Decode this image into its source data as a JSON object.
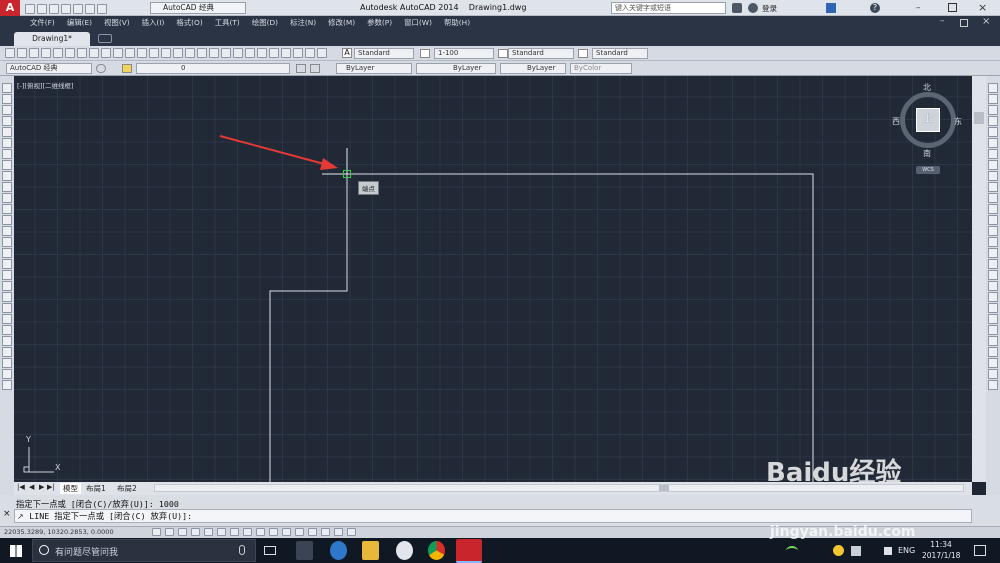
{
  "app": {
    "title": "Autodesk AutoCAD 2014",
    "document": "Drawing1.dwg",
    "workspace": "AutoCAD 经典",
    "search_placeholder": "键入关键字或短语",
    "login": "登录"
  },
  "menu": [
    "文件(F)",
    "编辑(E)",
    "视图(V)",
    "插入(I)",
    "格式(O)",
    "工具(T)",
    "绘图(D)",
    "标注(N)",
    "修改(M)",
    "参数(P)",
    "窗口(W)",
    "帮助(H)"
  ],
  "doc_tab": "Drawing1*",
  "styles": {
    "text_style": "Standard",
    "dim_scale": "1-100",
    "table_style": "Standard",
    "multileader_style": "Standard"
  },
  "props": {
    "workspace": "AutoCAD 经典",
    "layer": "0",
    "color": "ByLayer",
    "linetype": "ByLayer",
    "lineweight": "ByLayer",
    "plotstyle": "ByColor"
  },
  "viewport": {
    "label": "[-][俯视][二维线框]",
    "tooltip": "端点",
    "ucs_x": "X",
    "ucs_y": "Y"
  },
  "viewcube": {
    "north": "北",
    "south": "南",
    "east": "东",
    "west": "西",
    "top": "上",
    "wcs": "WCS"
  },
  "layout_tabs": [
    "模型",
    "布局1",
    "布局2"
  ],
  "command": {
    "history": "指定下一点或 [闭合(C)/放弃(U)]: 1000",
    "prompt": "LINE 指定下一点或 [闭合(C) 放弃(U)]:"
  },
  "status": {
    "coords": "22035.3289, 10320.2853, 0.0000"
  },
  "taskbar": {
    "search": "有问题尽管问我",
    "lang": "ENG",
    "time": "11:34",
    "date": "2017/1/18"
  },
  "watermark": {
    "brand": "Baidu经验",
    "url": "jingyan.baidu.com"
  },
  "colors": {
    "canvas": "#212836",
    "accent": "#c8252c",
    "annotation_arrow": "#e53935",
    "snap": "#35d04a"
  }
}
